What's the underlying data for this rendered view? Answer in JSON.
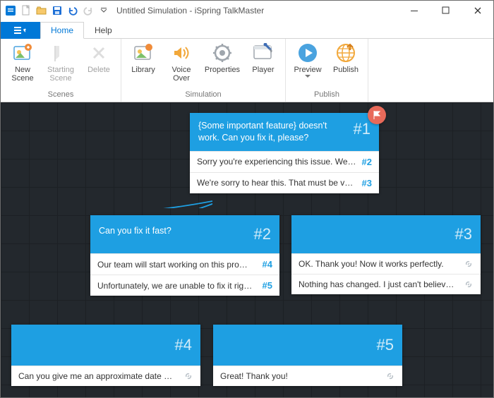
{
  "window": {
    "title": "Untitled Simulation - iSpring TalkMaster"
  },
  "tabs": {
    "home": "Home",
    "help": "Help"
  },
  "ribbon": {
    "scenes_group": "Scenes",
    "simulation_group": "Simulation",
    "publish_group": "Publish",
    "new_scene": "New\nScene",
    "starting_scene": "Starting\nScene",
    "delete": "Delete",
    "library": "Library",
    "voice_over": "Voice\nOver",
    "properties": "Properties",
    "player": "Player",
    "preview": "Preview",
    "publish": "Publish"
  },
  "nodes": {
    "n1": {
      "num": "#1",
      "question": "{Some important feature} doesn't work. Can you fix it, please?",
      "replies": [
        {
          "text": "Sorry you're experiencing this issue. We …",
          "tag": "#2"
        },
        {
          "text": "We're sorry to hear this. That must be v…",
          "tag": "#3"
        }
      ]
    },
    "n2": {
      "num": "#2",
      "question": "Can you fix it fast?",
      "replies": [
        {
          "text": "Our team will start working on this pro…",
          "tag": "#4"
        },
        {
          "text": "Unfortunately, we are unable to fix it rig…",
          "tag": "#5"
        }
      ]
    },
    "n3": {
      "num": "#3",
      "question": "",
      "replies": [
        {
          "text": "OK. Thank you! Now it works perfectly.",
          "tag": ""
        },
        {
          "text": "Nothing has changed. I just can't believ…",
          "tag": ""
        }
      ]
    },
    "n4": {
      "num": "#4",
      "question": "",
      "replies": [
        {
          "text": "Can you give me an approximate date …",
          "tag": ""
        }
      ]
    },
    "n5": {
      "num": "#5",
      "question": "",
      "replies": [
        {
          "text": "Great! Thank you!",
          "tag": ""
        }
      ]
    }
  }
}
